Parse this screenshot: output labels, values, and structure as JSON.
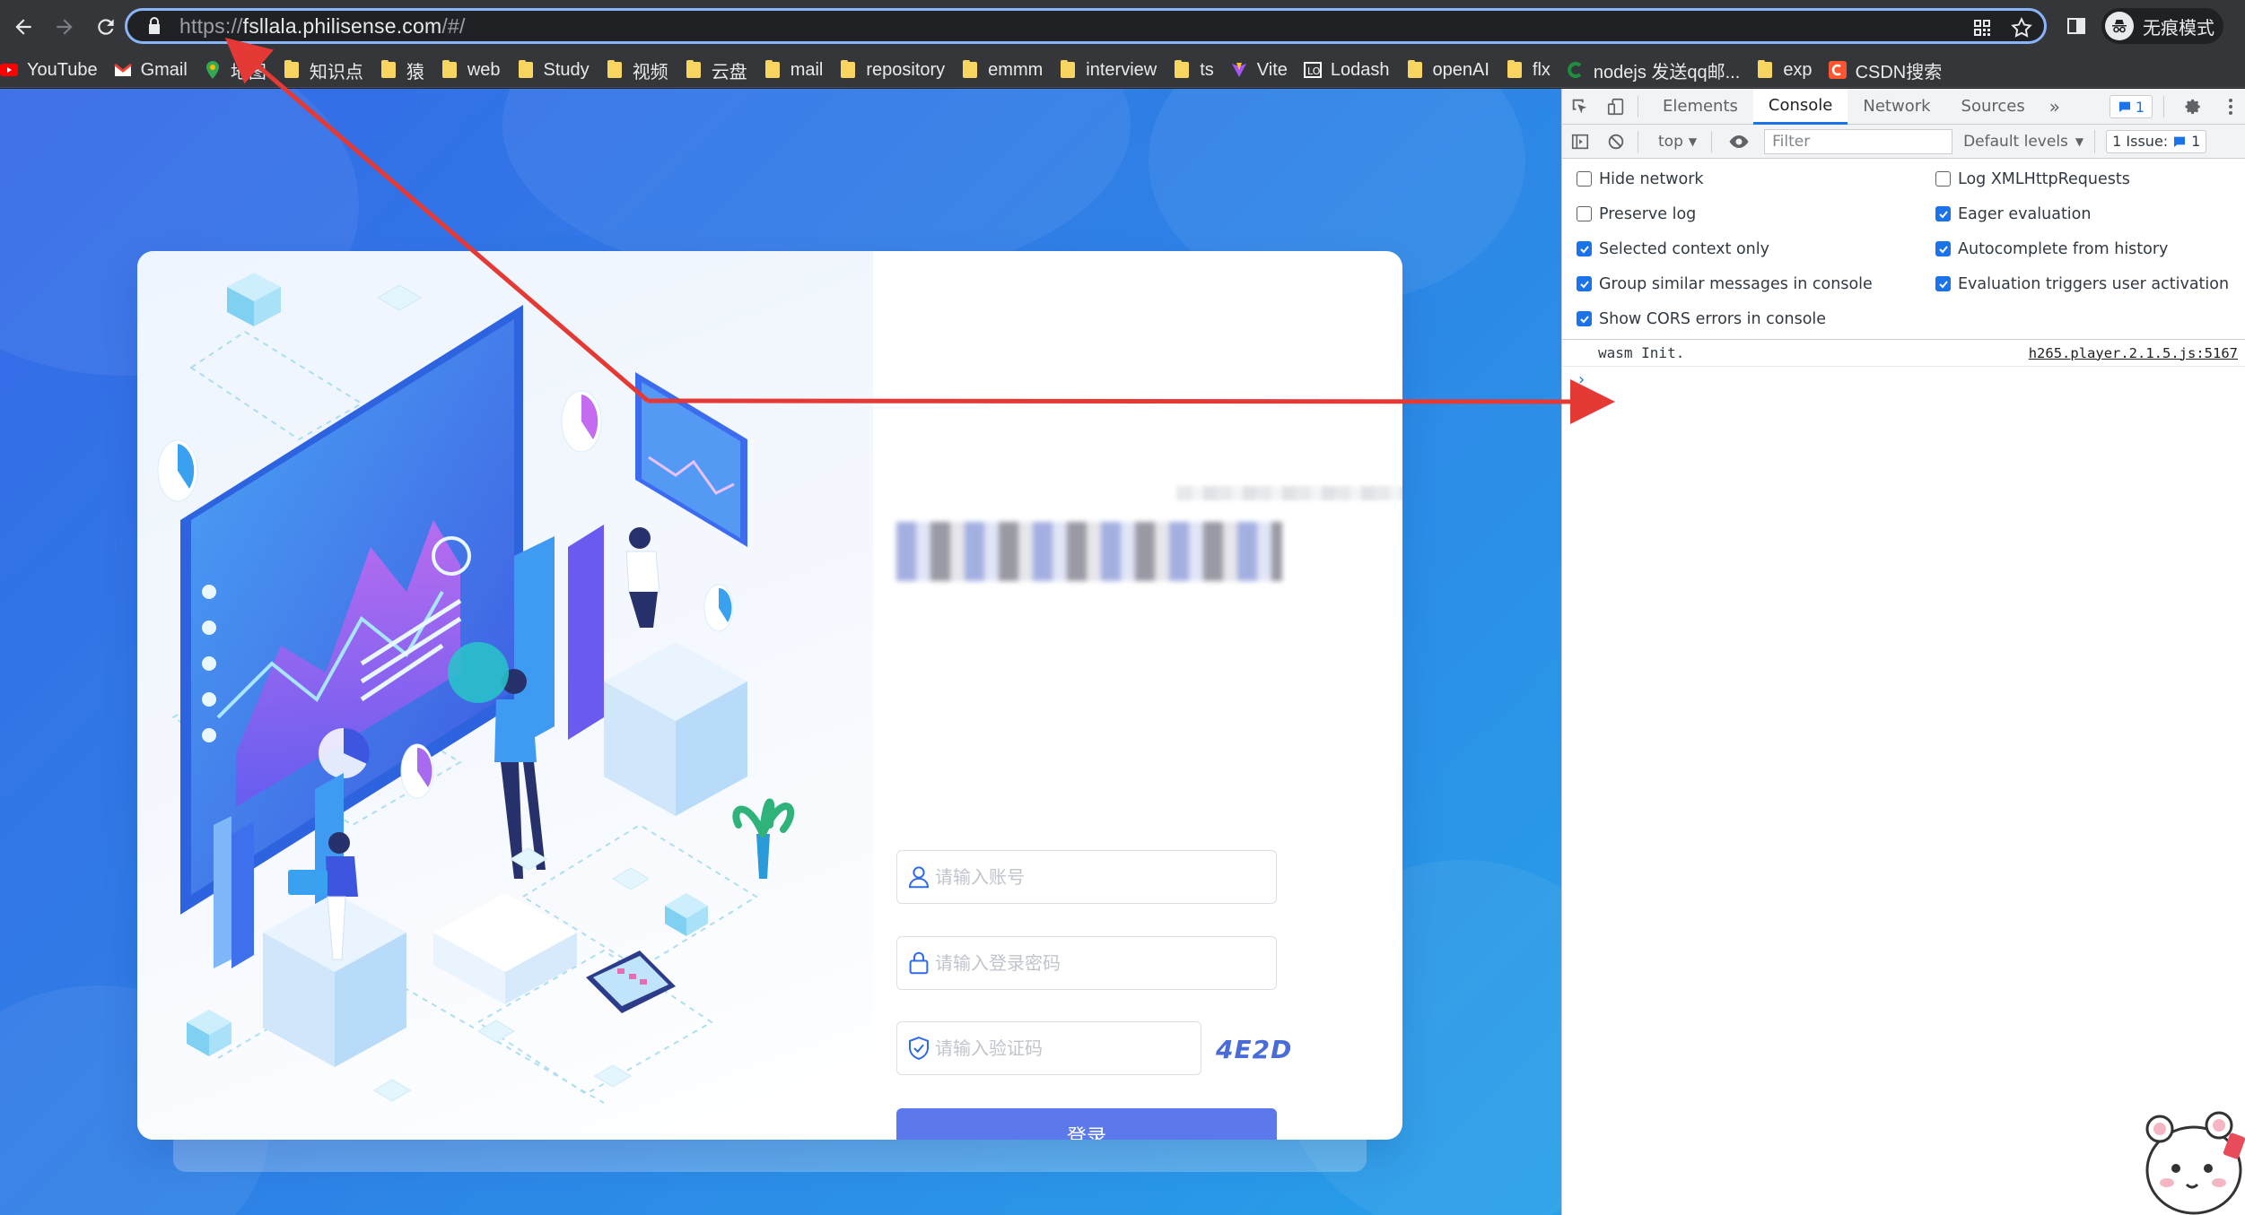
{
  "browser": {
    "url_scheme": "https://",
    "url_host": "fsllala.philisense.com",
    "url_path": "/#/",
    "profile_label": "无痕模式",
    "bookmarks": [
      {
        "label": "YouTube",
        "icon": "youtube-icon",
        "color": "#ff0000"
      },
      {
        "label": "Gmail",
        "icon": "gmail-icon",
        "color": "#ea4335"
      },
      {
        "label": "地图",
        "icon": "maps-icon",
        "color": "#34a853"
      },
      {
        "label": "知识点",
        "icon": "folder-icon",
        "color": "#f7d560"
      },
      {
        "label": "猿",
        "icon": "folder-icon",
        "color": "#f7d560"
      },
      {
        "label": "web",
        "icon": "folder-icon",
        "color": "#f7d560"
      },
      {
        "label": "Study",
        "icon": "folder-icon",
        "color": "#f7d560"
      },
      {
        "label": "视频",
        "icon": "folder-icon",
        "color": "#f7d560"
      },
      {
        "label": "云盘",
        "icon": "folder-icon",
        "color": "#f7d560"
      },
      {
        "label": "mail",
        "icon": "folder-icon",
        "color": "#f7d560"
      },
      {
        "label": "repository",
        "icon": "folder-icon",
        "color": "#f7d560"
      },
      {
        "label": "emmm",
        "icon": "folder-icon",
        "color": "#f7d560"
      },
      {
        "label": "interview",
        "icon": "folder-icon",
        "color": "#f7d560"
      },
      {
        "label": "ts",
        "icon": "folder-icon",
        "color": "#f7d560"
      },
      {
        "label": "Vite",
        "icon": "vite-icon",
        "color": "#a855f7"
      },
      {
        "label": "Lodash",
        "icon": "lodash-icon",
        "color": "#ffffff"
      },
      {
        "label": "openAI",
        "icon": "folder-icon",
        "color": "#f7d560"
      },
      {
        "label": "flx",
        "icon": "folder-icon",
        "color": "#f7d560"
      },
      {
        "label": "nodejs 发送qq邮...",
        "icon": "c-icon",
        "color": "#1e8e3e"
      },
      {
        "label": "exp",
        "icon": "folder-icon",
        "color": "#f7d560"
      },
      {
        "label": "CSDN搜索",
        "icon": "csdn-icon",
        "color": "#fc5531"
      }
    ]
  },
  "login": {
    "account_placeholder": "请输入账号",
    "password_placeholder": "请输入登录密码",
    "captcha_placeholder": "请输入验证码",
    "captcha_code": "4E2D",
    "submit_label": "登录"
  },
  "devtools": {
    "tabs": [
      "Elements",
      "Console",
      "Network",
      "Sources"
    ],
    "active_tab": "Console",
    "message_count": "1",
    "context": "top",
    "filter_placeholder": "Filter",
    "levels_label": "Default levels",
    "issues_label": "1 Issue:",
    "issues_count": "1",
    "settings_left": [
      {
        "label": "Hide network",
        "checked": false
      },
      {
        "label": "Preserve log",
        "checked": false
      },
      {
        "label": "Selected context only",
        "checked": true
      },
      {
        "label": "Group similar messages in console",
        "checked": true
      },
      {
        "label": "Show CORS errors in console",
        "checked": true
      }
    ],
    "settings_right": [
      {
        "label": "Log XMLHttpRequests",
        "checked": false
      },
      {
        "label": "Eager evaluation",
        "checked": true
      },
      {
        "label": "Autocomplete from history",
        "checked": true
      },
      {
        "label": "Evaluation triggers user activation",
        "checked": true
      }
    ],
    "console_messages": [
      {
        "text": "wasm Init.",
        "source": "h265.player.2.1.5.js:5167"
      }
    ],
    "prompt_symbol": "›"
  },
  "colors": {
    "accent": "#1a73e8",
    "login_button": "#5b79ea",
    "annotation_arrow": "#e53935"
  }
}
